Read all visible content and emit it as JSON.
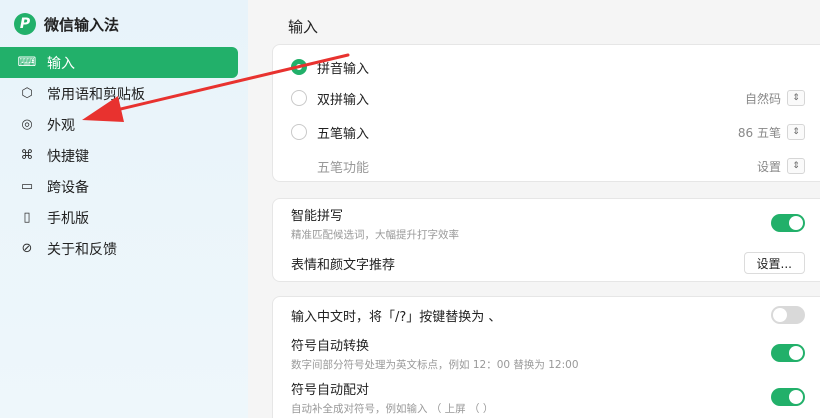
{
  "app": {
    "name": "微信输入法",
    "logo_glyph": "P"
  },
  "sidebar": {
    "items": [
      {
        "label": "输入",
        "icon": "keyboard-icon",
        "glyph": "⌨",
        "active": true
      },
      {
        "label": "常用语和剪贴板",
        "icon": "cube-icon",
        "glyph": "⬡",
        "active": false
      },
      {
        "label": "外观",
        "icon": "appearance-icon",
        "glyph": "◎",
        "active": false
      },
      {
        "label": "快捷键",
        "icon": "command-icon",
        "glyph": "⌘",
        "active": false
      },
      {
        "label": "跨设备",
        "icon": "devices-icon",
        "glyph": "▭",
        "active": false
      },
      {
        "label": "手机版",
        "icon": "phone-icon",
        "glyph": "▯",
        "active": false
      },
      {
        "label": "关于和反馈",
        "icon": "about-icon",
        "glyph": "⊘",
        "active": false
      }
    ]
  },
  "main": {
    "section_title": "输入",
    "methods": {
      "pinyin": {
        "label": "拼音输入",
        "checked": true
      },
      "shuangpin": {
        "label": "双拼输入",
        "value": "自然码",
        "checked": false
      },
      "wubi": {
        "label": "五笔输入",
        "value": "86 五笔",
        "checked": false
      },
      "wubi_func": {
        "label": "五笔功能",
        "value": "设置"
      }
    },
    "smart": {
      "title": "智能拼写",
      "subtitle": "精准匹配候选词，大幅提升打字效率",
      "enabled": true
    },
    "emoji": {
      "title": "表情和颜文字推荐",
      "button": "设置..."
    },
    "slash": {
      "title": "输入中文时，将「/?」按键替换为 、",
      "enabled": false
    },
    "punct": {
      "title": "符号自动转换",
      "subtitle": "数字间部分符号处理为英文标点，例如 12：00 替换为 12:00",
      "enabled": true
    },
    "pair": {
      "title": "符号自动配对",
      "subtitle": "自动补全成对符号，例如输入 （ 上屏 （ ）",
      "enabled": true
    }
  },
  "colors": {
    "accent": "#22b06a",
    "arrow": "#e8322f"
  }
}
